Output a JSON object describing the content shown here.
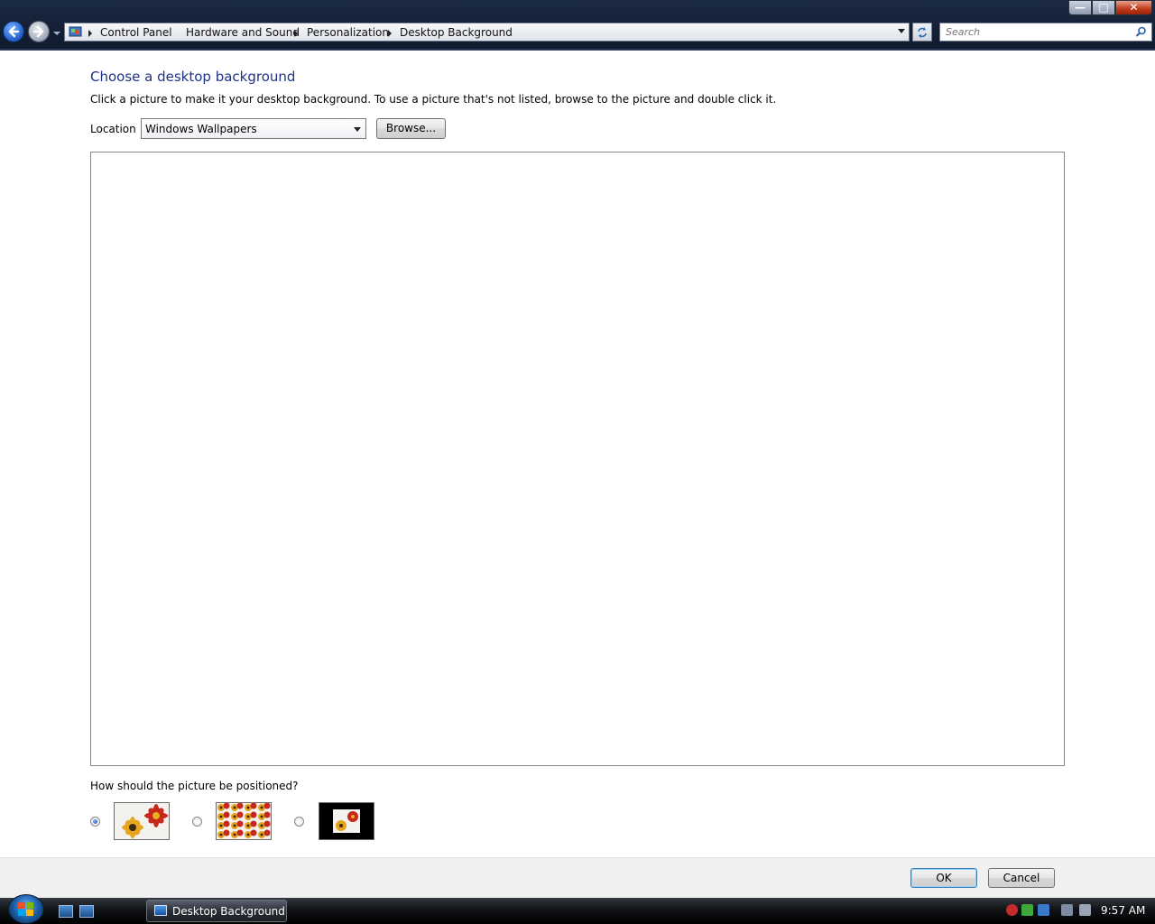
{
  "window": {
    "controls": {
      "minimize": "—",
      "maximize": "□",
      "close": "✕"
    }
  },
  "address_bar": {
    "breadcrumbs": [
      "Control Panel",
      "Hardware and Sound",
      "Personalization",
      "Desktop Background"
    ],
    "icons": {
      "location": "control-panel-icon",
      "dropdown": "chevron-down-icon",
      "refresh": "refresh-icon"
    }
  },
  "search": {
    "placeholder": "Search",
    "icon": "search-icon"
  },
  "content": {
    "title": "Choose a desktop background",
    "instructions": "Click a picture to make it your desktop background. To use a picture that's not listed, browse to the picture and double click it.",
    "location_label": "Location",
    "location_value": "Windows Wallpapers",
    "browse_label": "Browse...",
    "position_question": "How should the picture be positioned?",
    "position_options": [
      {
        "name": "fit-to-screen",
        "selected": true
      },
      {
        "name": "tile",
        "selected": false
      },
      {
        "name": "center",
        "selected": false
      }
    ]
  },
  "footer": {
    "ok_label": "OK",
    "cancel_label": "Cancel"
  },
  "taskbar": {
    "active_window": "Desktop Background",
    "clock": "9:57 AM"
  },
  "colors": {
    "title_blue": "#1e3287",
    "chrome_dark": "#16233a",
    "taskbar_black": "#101215"
  }
}
